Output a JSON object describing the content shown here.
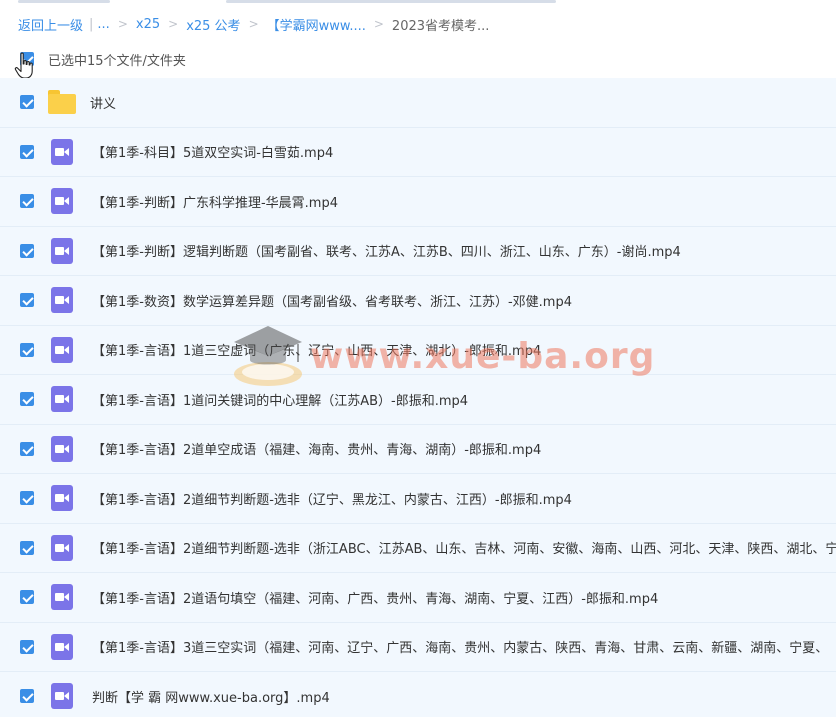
{
  "breadcrumb": {
    "back": "返回上一级",
    "ellipsis": "...",
    "items": [
      "x25",
      "x25 公考",
      "【学霸网www....",
      "2023省考模考..."
    ]
  },
  "selection": {
    "text": "已选中15个文件/文件夹"
  },
  "files": [
    {
      "name": "讲义",
      "type": "folder"
    },
    {
      "name": "【第1季-科目】5道双空实词-白雪茹.mp4",
      "type": "video"
    },
    {
      "name": "【第1季-判断】广东科学推理-华晨霄.mp4",
      "type": "video"
    },
    {
      "name": "【第1季-判断】逻辑判断题（国考副省、联考、江苏A、江苏B、四川、浙江、山东、广东）-谢尚.mp4",
      "type": "video"
    },
    {
      "name": "【第1季-数资】数学运算差异题（国考副省级、省考联考、浙江、江苏）-邓健.mp4",
      "type": "video"
    },
    {
      "name": "【第1季-言语】1道三空虚词（广东、辽宁、山西、天津、湖北）-郎振和.mp4",
      "type": "video"
    },
    {
      "name": "【第1季-言语】1道问关键词的中心理解（江苏AB）-郎振和.mp4",
      "type": "video"
    },
    {
      "name": "【第1季-言语】2道单空成语（福建、海南、贵州、青海、湖南）-郎振和.mp4",
      "type": "video"
    },
    {
      "name": "【第1季-言语】2道细节判断题-选非（辽宁、黑龙江、内蒙古、江西）-郎振和.mp4",
      "type": "video"
    },
    {
      "name": "【第1季-言语】2道细节判断题-选非（浙江ABC、江苏AB、山东、吉林、河南、安徽、海南、山西、河北、天津、陕西、湖北、宁",
      "type": "video"
    },
    {
      "name": "【第1季-言语】2道语句填空（福建、河南、广西、贵州、青海、湖南、宁夏、江西）-郎振和.mp4",
      "type": "video"
    },
    {
      "name": "【第1季-言语】3道三空实词（福建、河南、辽宁、广西、海南、贵州、内蒙古、陕西、青海、甘肃、云南、新疆、湖南、宁夏、",
      "type": "video"
    },
    {
      "name": "判断【学 霸 网www.xue-ba.org】.mp4",
      "type": "video"
    }
  ],
  "watermark": {
    "text": "www.xue-ba.org"
  },
  "colors": {
    "accent": "#3a8ee6",
    "row_bg": "#f2f8fe",
    "video_icon": "#7b74e8",
    "folder_icon": "#fbd04a"
  }
}
